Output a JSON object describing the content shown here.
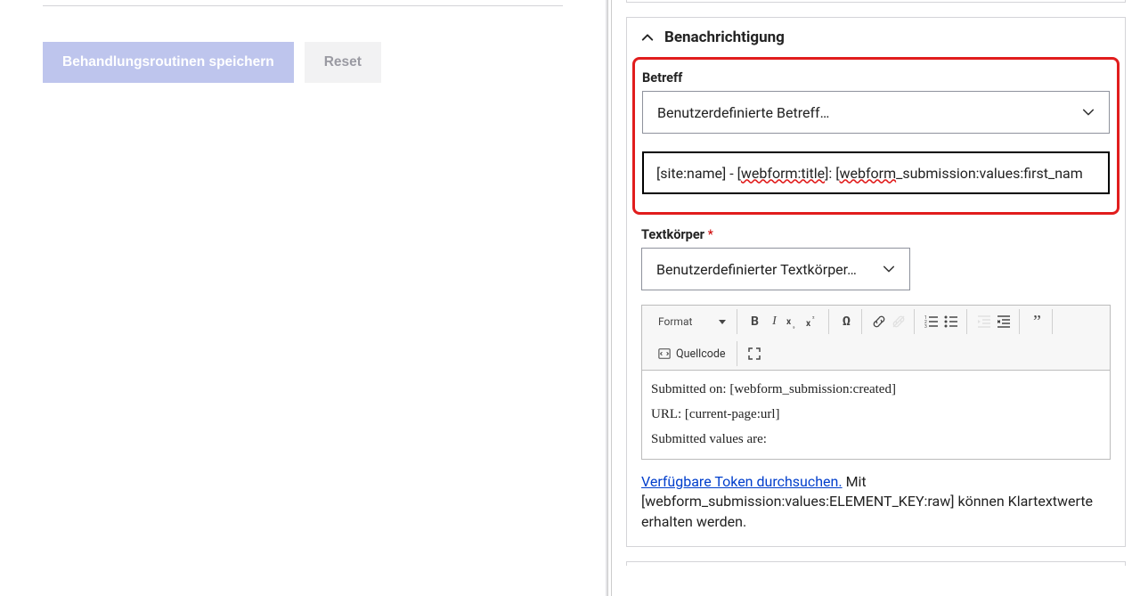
{
  "left": {
    "save_label": "Behandlungsroutinen speichern",
    "reset_label": "Reset"
  },
  "notification": {
    "title": "Benachrichtigung",
    "subject": {
      "label": "Betreff",
      "select_value": "Benutzerdefinierte Betreff…",
      "input_prefix": "[site:name] - [",
      "input_token1": "webform:title",
      "input_mid": "]: [",
      "input_token2": "webform",
      "input_suffix": "_submission:values:first_nam"
    },
    "body": {
      "label": "Textkörper",
      "select_value": "Benutzerdefinierter Textkörper…",
      "format_label": "Format",
      "source_label": "Quellcode",
      "lines": {
        "l1": "Submitted on: [webform_submission:created]",
        "l2": "URL: [current-page:url]",
        "l3": "Submitted values are:"
      }
    },
    "help": {
      "link": "Verfügbare Token durchsuchen.",
      "text": " Mit [webform_submission:values:ELEMENT_KEY:raw] können Klartextwerte erhalten werden."
    }
  }
}
